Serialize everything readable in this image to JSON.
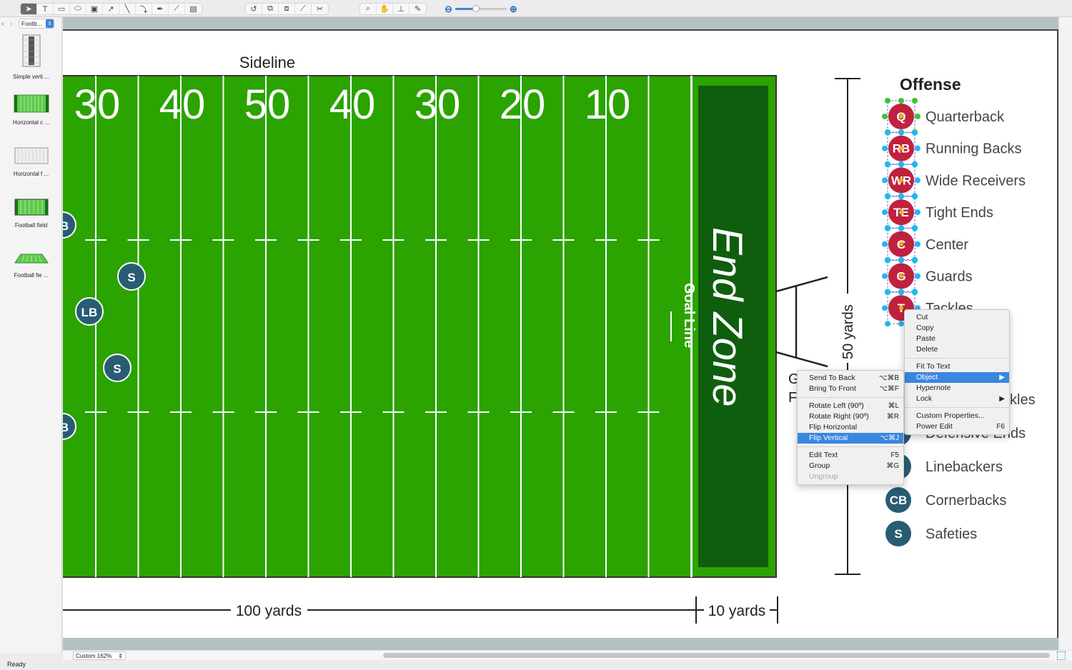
{
  "toolbar": {
    "drawing_tools": [
      "select-arrow-icon",
      "text-box-icon",
      "rectangle-icon",
      "ellipse-icon",
      "frame-icon",
      "arrow-line-icon",
      "line-icon",
      "curve-icon",
      "pen-icon",
      "bezier-icon",
      "note-icon"
    ],
    "edit_tools": [
      "rotate-icon",
      "group-icon",
      "ungroup-icon",
      "connector-add-icon",
      "connector-cut-icon"
    ],
    "view_tools": [
      "zoom-glass-icon",
      "hand-pan-icon",
      "stamp-icon",
      "eyedropper-icon"
    ],
    "zoom_level": 0.4
  },
  "sidebar": {
    "library": "Footb...",
    "items": [
      {
        "label": "Simple verti ..."
      },
      {
        "label": "Horizontal c ..."
      },
      {
        "label": "Horizontal f ..."
      },
      {
        "label": "Football field"
      },
      {
        "label": "Football fie ..."
      }
    ]
  },
  "diagram": {
    "sideline_label": "Sideline",
    "yard_numbers": [
      "30",
      "40",
      "50",
      "40",
      "30",
      "20",
      "10"
    ],
    "end_zone_label": "End Zone",
    "goal_line_label": "Goal Line",
    "width_label": "50 yards",
    "length_label": "100 yards",
    "endzone_length_label": "10 yards",
    "goal_post_label_partial": [
      "G",
      "F"
    ],
    "field_players": [
      {
        "label": "B"
      },
      {
        "label": "S"
      },
      {
        "label": "LB"
      },
      {
        "label": "S"
      },
      {
        "label": "B"
      }
    ],
    "offense_title": "Offense",
    "offense": [
      {
        "abbr": "Q",
        "label": "Quarterback"
      },
      {
        "abbr": "RB",
        "label": "Running Backs"
      },
      {
        "abbr": "WR",
        "label": "Wide Receivers"
      },
      {
        "abbr": "TE",
        "label": "Tight Ends"
      },
      {
        "abbr": "C",
        "label": "Center"
      },
      {
        "abbr": "G",
        "label": "Guards"
      },
      {
        "abbr": "T",
        "label": "Tackles"
      }
    ],
    "defense": [
      {
        "abbr": "",
        "label": "ckles"
      },
      {
        "abbr": "",
        "label": "Defensive Ends"
      },
      {
        "abbr": "B",
        "label": "Linebackers"
      },
      {
        "abbr": "CB",
        "label": "Cornerbacks"
      },
      {
        "abbr": "S",
        "label": "Safeties"
      }
    ],
    "colors": {
      "field": "#2ba300",
      "end_zone": "#0e5e0e",
      "offense": "#c0213f",
      "defense": "#285c72",
      "handle_green": "#39c43b",
      "handle_blue": "#1fb8f0"
    }
  },
  "context_menu": {
    "items": [
      {
        "label": "Cut",
        "shortcut": ""
      },
      {
        "label": "Copy",
        "shortcut": ""
      },
      {
        "label": "Paste",
        "shortcut": ""
      },
      {
        "label": "Delete",
        "shortcut": ""
      },
      {
        "sep": true
      },
      {
        "label": "Fit To Text",
        "shortcut": ""
      },
      {
        "label": "Object",
        "shortcut": "▶",
        "selected": true
      },
      {
        "label": "Hypernote",
        "shortcut": ""
      },
      {
        "label": "Lock",
        "shortcut": "▶"
      },
      {
        "sep": true
      },
      {
        "label": "Custom Properties...",
        "shortcut": ""
      },
      {
        "label": "Power Edit",
        "shortcut": "F6"
      }
    ]
  },
  "submenu": {
    "items": [
      {
        "label": "Send To Back",
        "shortcut": "⌥⌘B"
      },
      {
        "label": "Bring To Front",
        "shortcut": "⌥⌘F"
      },
      {
        "sep": true
      },
      {
        "label": "Rotate Left (90º)",
        "shortcut": "⌘L"
      },
      {
        "label": "Rotate Right (90º)",
        "shortcut": "⌘R"
      },
      {
        "label": "Flip Horizontal",
        "shortcut": ""
      },
      {
        "label": "Flip Vertical",
        "shortcut": "⌥⌘J",
        "selected": true
      },
      {
        "sep": true
      },
      {
        "label": "Edit Text",
        "shortcut": "F5"
      },
      {
        "label": "Group",
        "shortcut": "⌘G"
      },
      {
        "label": "Ungroup",
        "shortcut": "",
        "disabled": true
      }
    ]
  },
  "bottom": {
    "zoom_select": "Custom 162%",
    "status": "Ready"
  }
}
